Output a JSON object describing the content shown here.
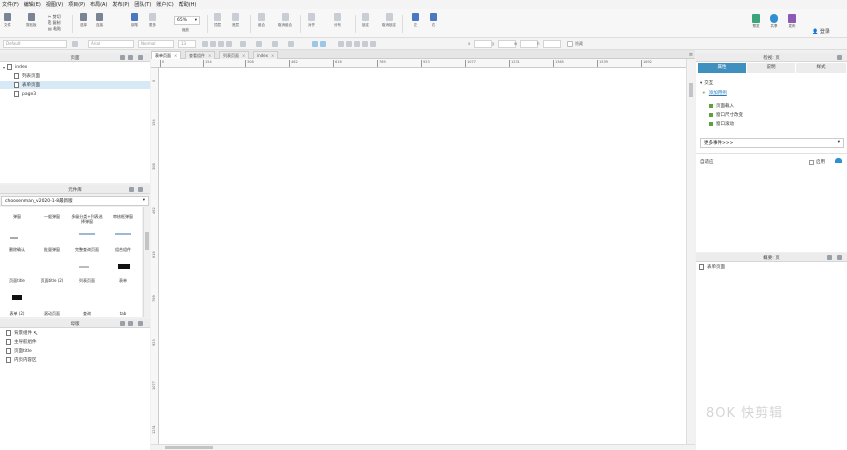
{
  "menu": [
    "文件(F)",
    "编辑(E)",
    "视图(V)",
    "项目(P)",
    "布局(A)",
    "发布(P)",
    "团队(T)",
    "账户(C)",
    "帮助(H)"
  ],
  "toolbar": {
    "file_label": "文件",
    "clipboard_label": "剪贴板",
    "cut_label": "剪切",
    "copy_label": "复制",
    "paste_label": "粘贴",
    "select_label": "选择",
    "connect_label": "连接",
    "pen_label": "钢笔",
    "more_label": "更多",
    "zoom_value": "65%",
    "zoom_label": "缩放",
    "top_label": "顶层",
    "bottom_label": "底层",
    "group_label": "组合",
    "ungroup_label": "取消组合",
    "align_label": "对齐",
    "distribute_label": "分布",
    "lock_label": "锁定",
    "unlock_label": "取消锁定",
    "left_label": "左",
    "right_label": "右",
    "preview_label": "预览",
    "share_label": "共享",
    "publish_label": "发布",
    "login_label": "登录"
  },
  "stylebar": {
    "style": "Default",
    "font": "Arial",
    "weight": "Normal",
    "size": "13",
    "x_label": "x",
    "y_label": "y",
    "w_label": "w",
    "h_label": "h",
    "hidden_label": "隐藏"
  },
  "pages_panel": {
    "title": "页面",
    "root": "index",
    "children": [
      "列表页面",
      "表单页面",
      "page3"
    ],
    "selected_index": 1
  },
  "library_panel": {
    "title": "元件库",
    "selected_library": "choosenman_v2020-1-8最新版",
    "items": [
      [
        "弹窗",
        "一般弹窗",
        "多级分类+列表选择弹窗",
        "审核框弹窗"
      ],
      [
        "删除确认",
        "批量弹窗",
        "完整查询页面",
        "组合组件"
      ],
      [
        "页面title",
        "页面title (2)",
        "列表页面",
        "表单"
      ],
      [
        "表单 (2)",
        "滚动页面",
        "查询",
        "tab"
      ]
    ]
  },
  "masters_panel": {
    "title": "母版",
    "items": [
      "背景组件",
      "主导航组件",
      "页面title",
      "内页内容区"
    ]
  },
  "canvas": {
    "tabs": [
      "表单页面",
      "查看组件",
      "列表页面",
      "index"
    ],
    "active_tab": 0,
    "ruler_h": [
      "0",
      "154",
      "308",
      "462",
      "616",
      "769",
      "923",
      "1077",
      "1231",
      "1385",
      "1539",
      "1692"
    ],
    "ruler_v": [
      "0",
      "154",
      "308",
      "462",
      "616",
      "769",
      "923",
      "1077",
      "1231"
    ]
  },
  "inspector": {
    "title": "检视: 页",
    "tabs": [
      "属性",
      "说明",
      "样式"
    ],
    "active_tab": 0,
    "section": "交互",
    "add_case": "添加用例",
    "events": [
      "页面载入",
      "窗口尺寸改变",
      "窗口滚动"
    ],
    "more_events": "更多事件>>>",
    "adaptive_label": "自适应",
    "enable_label": "启用"
  },
  "outline_panel": {
    "title": "概要: 页",
    "item": "表单页面"
  },
  "watermark": "8OK 快剪辑",
  "colors": {
    "accent": "#3f8fbf",
    "selection": "#d6e9f5",
    "event_leaf": "#5fa03a"
  }
}
